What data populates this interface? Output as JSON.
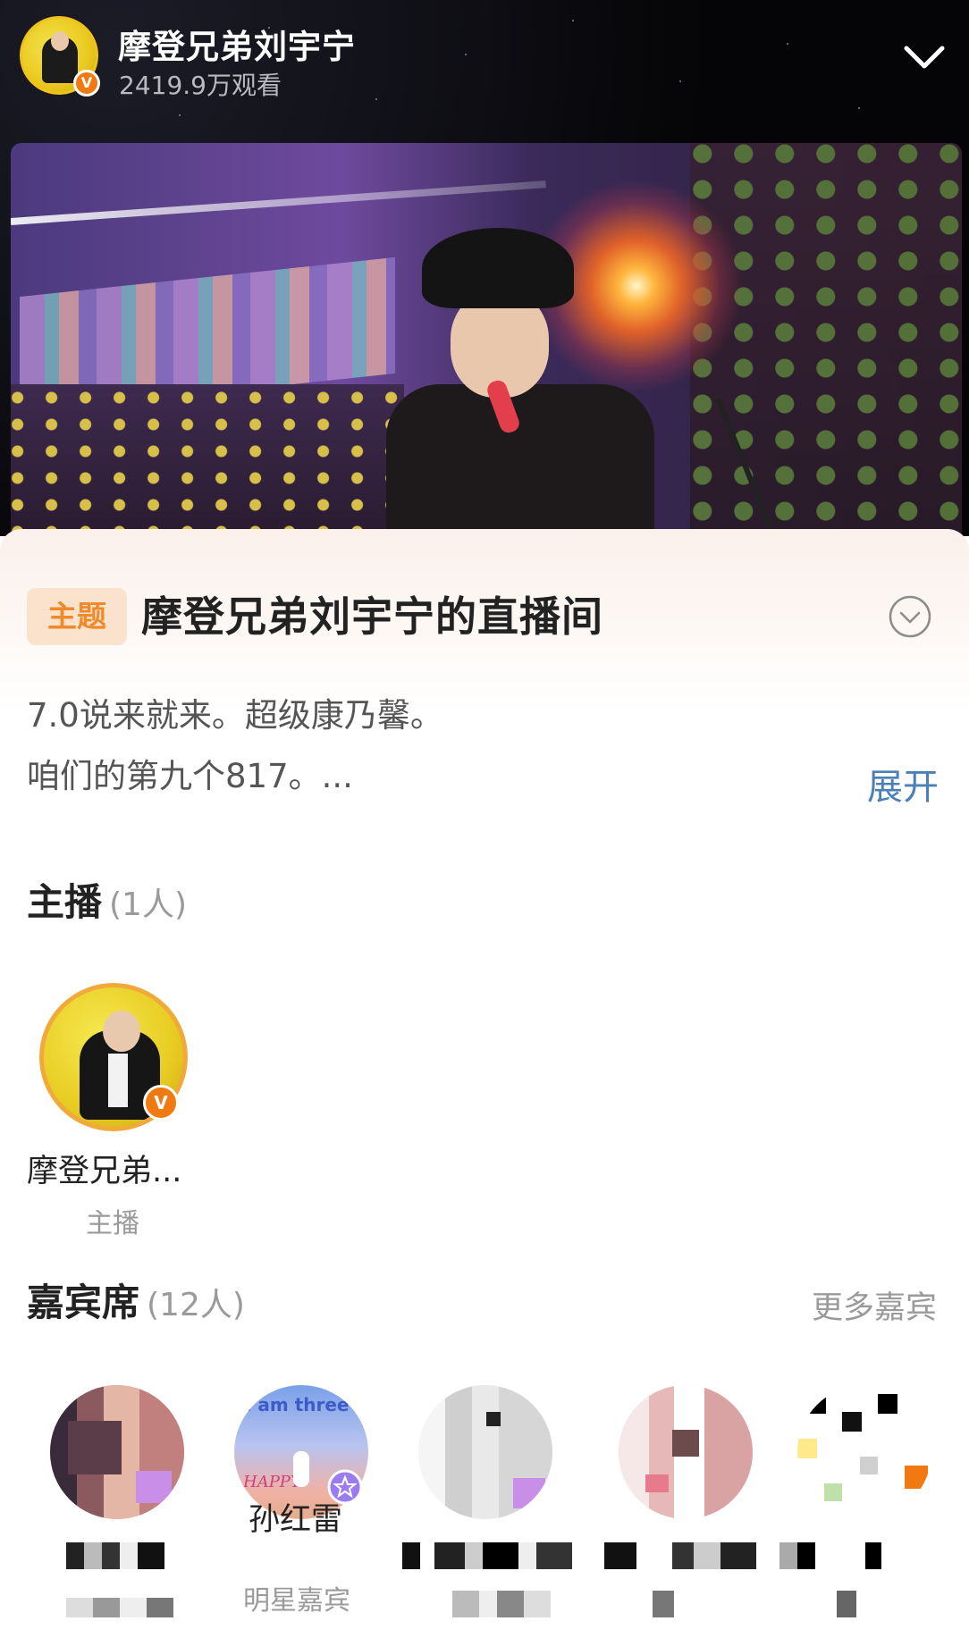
{
  "header": {
    "name": "摩登兄弟刘宇宁",
    "views": "2419.9万观看",
    "verified_badge": "V",
    "collapse_icon": "chevron-down-icon"
  },
  "topic": {
    "badge": "主题",
    "title": "摩登兄弟刘宇宁的直播间",
    "description_line1": "7.0说来就来。超级康乃馨。",
    "description_line2": "咱们的第九个817。...",
    "expand": "展开"
  },
  "hosts": {
    "title": "主播",
    "count": "(1人)",
    "items": [
      {
        "name": "摩登兄弟...",
        "role": "主播"
      }
    ]
  },
  "guests": {
    "title": "嘉宾席",
    "count": "(12人)",
    "more": "更多嘉宾",
    "items": [
      {
        "name": "",
        "role": ""
      },
      {
        "name": "孙红雷",
        "role": "明星嘉宾",
        "avatar_text": "I am three",
        "avatar_caption": "HAPPY"
      },
      {
        "name": "",
        "role": ""
      },
      {
        "name": "",
        "role": ""
      },
      {
        "name": "",
        "role": ""
      }
    ]
  },
  "colors": {
    "accent_orange": "#ef8a2a",
    "link_blue": "#4a7fb8",
    "verified_orange": "#f07a11"
  }
}
